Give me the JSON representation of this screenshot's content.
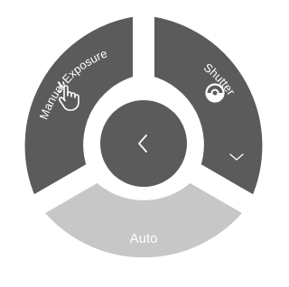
{
  "dial": {
    "segments": [
      {
        "id": "manual",
        "label": "Manual Exposure",
        "icon": "touch-hand-icon",
        "color": "#5b5b5b"
      },
      {
        "id": "shutter",
        "label": "Shutter",
        "icon": "shutter-icon",
        "color": "#5b5b5b"
      },
      {
        "id": "auto",
        "label": "Auto",
        "color": "#c7c7c7"
      }
    ],
    "center": {
      "icon": "chevron-left-icon",
      "color": "#5b5b5b"
    },
    "ring_color": "#ffffff",
    "shutter_hint_icon": "chevron-down-icon"
  }
}
